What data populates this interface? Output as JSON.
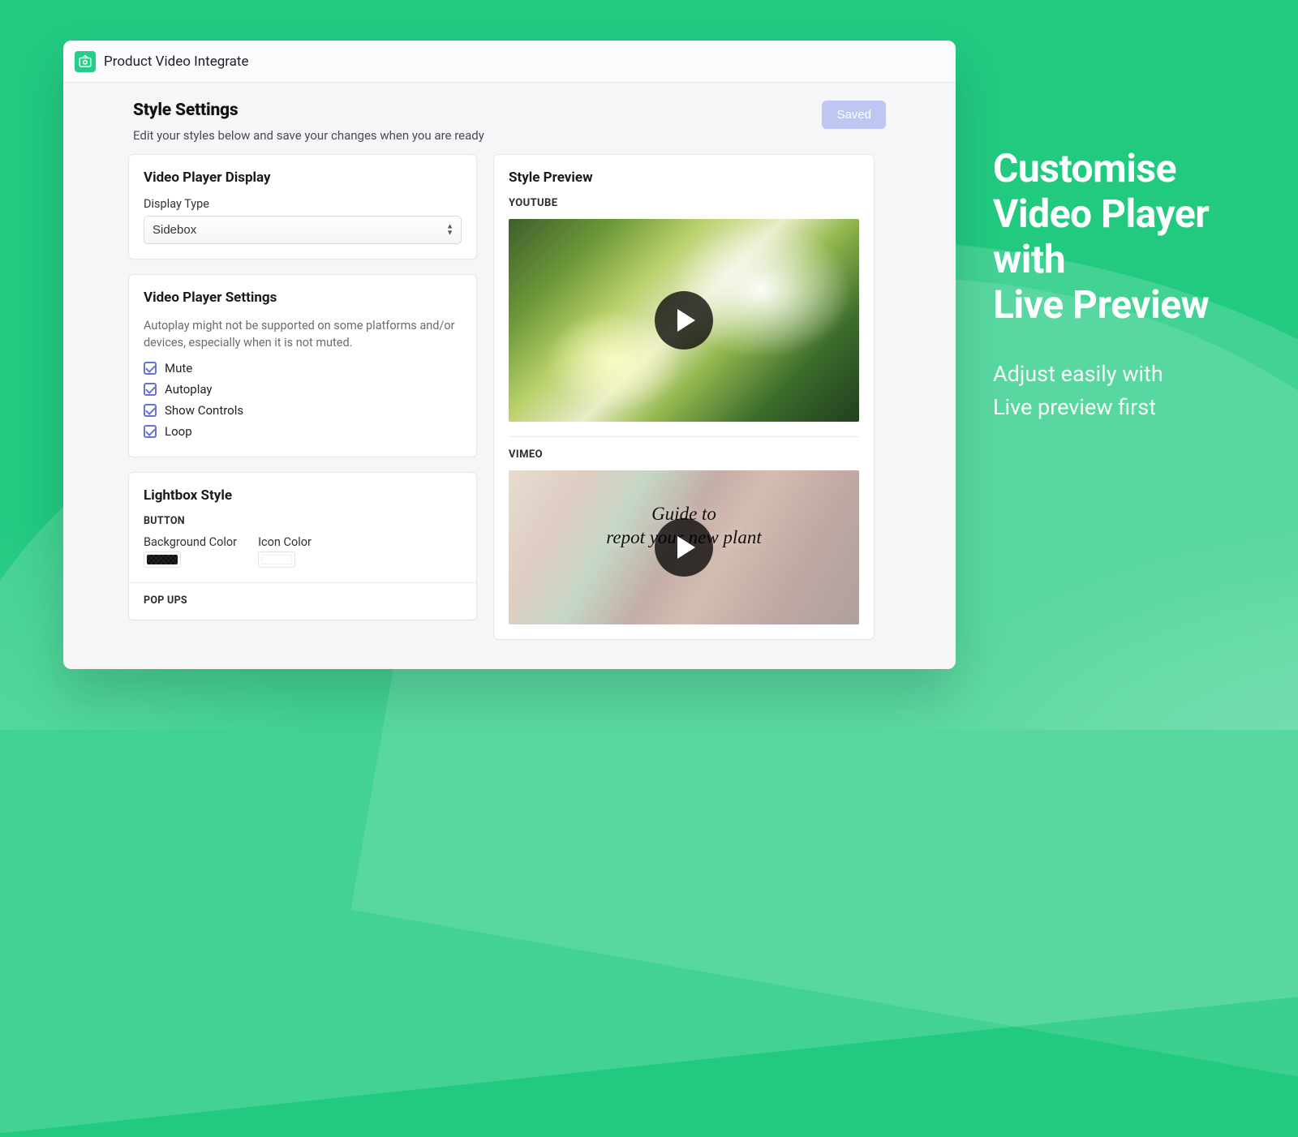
{
  "app": {
    "title": "Product Video Integrate"
  },
  "page": {
    "title": "Style Settings",
    "subtitle": "Edit your styles below and save your changes when you are ready",
    "saved_label": "Saved"
  },
  "display": {
    "card_title": "Video Player Display",
    "label": "Display Type",
    "selected": "Sidebox"
  },
  "settings": {
    "card_title": "Video Player Settings",
    "note": "Autoplay might not be supported on some platforms and/or devices, especially when it is not muted.",
    "mute_label": "Mute",
    "autoplay_label": "Autoplay",
    "show_controls_label": "Show Controls",
    "loop_label": "Loop"
  },
  "lightbox": {
    "card_title": "Lightbox Style",
    "button_section": "BUTTON",
    "bg_label": "Background Color",
    "icon_label": "Icon Color",
    "popups_section": "POP UPS",
    "bg_color": "#111111",
    "icon_color": "#ffffff"
  },
  "preview": {
    "card_title": "Style Preview",
    "youtube_label": "YOUTUBE",
    "vimeo_label": "VIMEO",
    "vimeo_caption_line1": "Guide to",
    "vimeo_caption_line2": "repot your new plant"
  },
  "promo": {
    "headline_l1": "Customise",
    "headline_l2": "Video Player",
    "headline_l3": "with",
    "headline_l4": "Live Preview",
    "sub_l1": "Adjust easily with",
    "sub_l2": "Live preview first"
  }
}
